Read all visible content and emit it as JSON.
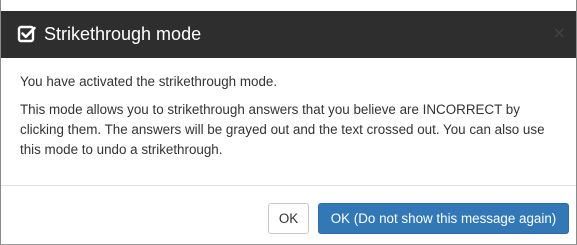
{
  "dialog": {
    "title": "Strikethrough mode",
    "title_icon": "check-square-icon",
    "close_icon": "close-icon",
    "close_glyph": "×",
    "body": {
      "paragraph_1": "You have activated the strikethrough mode.",
      "paragraph_2": "This mode allows you to strikethrough answers that you believe are INCORRECT by clicking them. The answers will be grayed out and the text crossed out. You can also use this mode to undo a strikethrough."
    },
    "buttons": {
      "ok_label": "OK",
      "ok_dont_show_label": "OK (Do not show this message again)"
    }
  },
  "colors": {
    "header_bg": "#2e2e2e",
    "header_text": "#ffffff",
    "primary_button": "#3278b7",
    "body_text": "#333333"
  }
}
